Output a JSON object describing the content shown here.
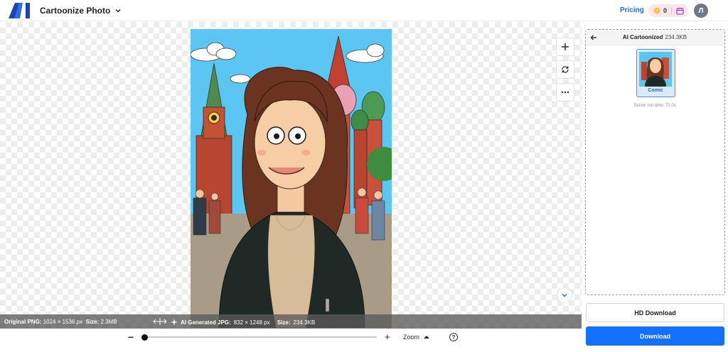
{
  "header": {
    "app_title": "Cartoonize Photo",
    "pricing_label": "Pricing",
    "credits_count": "0",
    "avatar_initial": "Л"
  },
  "canvas": {
    "info": {
      "original_label": "Original PNG:",
      "original_dims": "1024 × 1536 px",
      "original_size_label": "Size:",
      "original_size": "2.3MB",
      "generated_label": "AI Generated JPG:",
      "generated_dims": "832 × 1248 px",
      "generated_size_label": "Size:",
      "generated_size": "234.3KB"
    }
  },
  "zoom": {
    "label": "Zoom",
    "minus": "−",
    "plus": "+",
    "help": "?",
    "level": 0.0
  },
  "panel": {
    "title": "AI Cartoonized",
    "size": "234.3KB",
    "style_label": "Comic",
    "runtime": "Server run-time: 72.0s"
  },
  "buttons": {
    "hd_download": "HD Download",
    "download": "Download"
  },
  "colors": {
    "accent": "#1570ff",
    "pricing": "#1d6cff",
    "credits_bg": "#ffe6ec"
  }
}
